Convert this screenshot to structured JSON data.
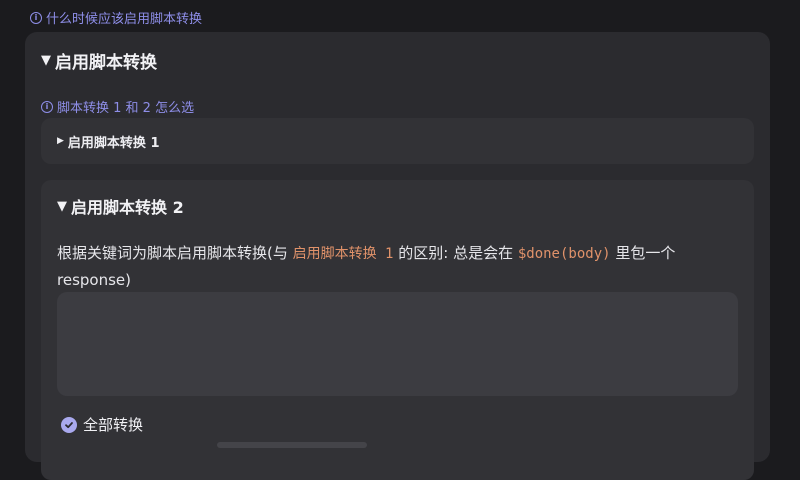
{
  "top_help_link": "什么时候应该启用脚本转换",
  "section": {
    "title": "启用脚本转换",
    "help_link": "脚本转换 1 和 2 怎么选",
    "option1": {
      "title": "启用脚本转换 1"
    },
    "option2": {
      "title": "启用脚本转换 2",
      "desc_prefix": "根据关键词为脚本启用脚本转换(与 ",
      "desc_code1": "启用脚本转换 1",
      "desc_mid": " 的区别: 总是会在 ",
      "desc_code2": "$done(body)",
      "desc_suffix": " 里包一个response)",
      "keywords_value": "",
      "checkbox_label": "全部转换",
      "checkbox_checked": true
    }
  },
  "colors": {
    "accent": "#8e8ee8",
    "code": "#e0926a",
    "card": "#2b2b2f",
    "inner_card": "#323236"
  }
}
